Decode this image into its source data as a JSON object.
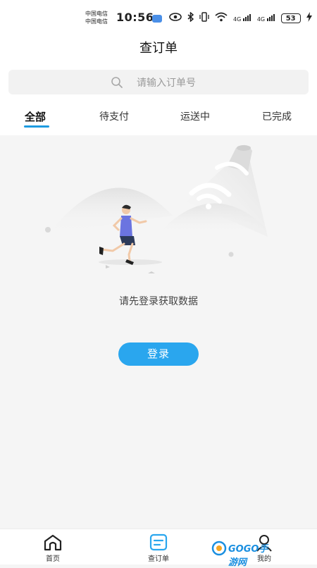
{
  "status_bar": {
    "carrier_1": "中国电信",
    "carrier_2": "中国电信",
    "time": "10:56",
    "signal_1": "4G",
    "signal_2": "4G",
    "battery": "53"
  },
  "header": {
    "title": "查订单"
  },
  "search": {
    "placeholder": "请输入订单号",
    "value": ""
  },
  "tabs": [
    {
      "label": "全部",
      "active": true
    },
    {
      "label": "待支付",
      "active": false
    },
    {
      "label": "运送中",
      "active": false
    },
    {
      "label": "已完成",
      "active": false
    }
  ],
  "empty_state": {
    "message": "请先登录获取数据",
    "login_button": "登录"
  },
  "bottom_nav": [
    {
      "label": "首页",
      "icon": "home-icon"
    },
    {
      "label": "查订单",
      "icon": "order-icon",
      "active": true
    },
    {
      "label": "我的",
      "icon": "user-icon"
    }
  ],
  "watermark": {
    "text": "GOGO手游网"
  },
  "colors": {
    "accent": "#2aa6ee",
    "tab_underline": "#1e9be0",
    "background": "#f5f5f5"
  }
}
